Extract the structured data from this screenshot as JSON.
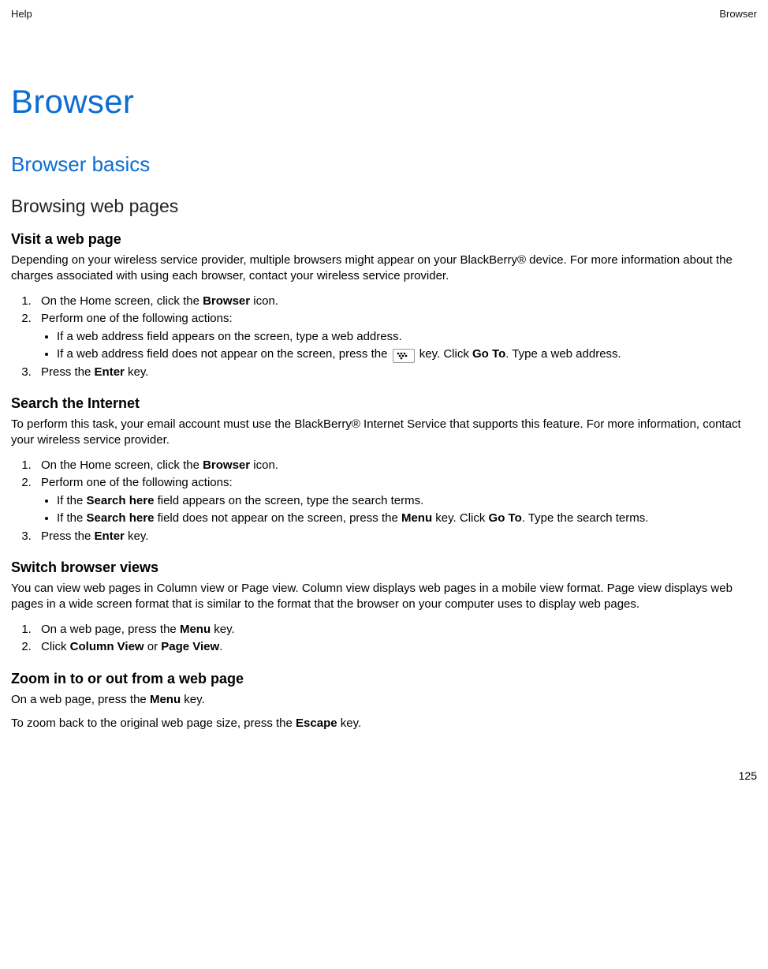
{
  "header": {
    "left": "Help",
    "right": "Browser"
  },
  "title": "Browser",
  "section": "Browser basics",
  "subsection": "Browsing web pages",
  "topics": {
    "visit": {
      "heading": "Visit a web page",
      "intro": "Depending on your wireless service provider, multiple browsers might appear on your BlackBerry® device. For more information about the charges associated with using each browser, contact your wireless service provider.",
      "step1_pre": "On the Home screen, click the ",
      "step1_b": "Browser",
      "step1_post": " icon.",
      "step2": "Perform one of the following actions:",
      "step2a": "If a web address field appears on the screen, type a web address.",
      "step2b_pre": "If a web address field does not appear on the screen, press the ",
      "step2b_mid": " key. Click ",
      "step2b_b": "Go To",
      "step2b_post": ". Type a web address.",
      "step3_pre": "Press the ",
      "step3_b": "Enter",
      "step3_post": " key."
    },
    "search": {
      "heading": "Search the Internet",
      "intro": "To perform this task, your email account must use the BlackBerry® Internet Service that supports this feature. For more information, contact your wireless service provider.",
      "step1_pre": "On the Home screen, click the ",
      "step1_b": "Browser",
      "step1_post": " icon.",
      "step2": "Perform one of the following actions:",
      "step2a_pre": "If the ",
      "step2a_b": "Search here",
      "step2a_post": " field appears on the screen, type the search terms.",
      "step2b_pre": "If the ",
      "step2b_b1": "Search here",
      "step2b_mid1": " field does not appear on the screen, press the ",
      "step2b_b2": "Menu",
      "step2b_mid2": " key. Click ",
      "step2b_b3": "Go To",
      "step2b_post": ". Type the search terms.",
      "step3_pre": "Press the ",
      "step3_b": "Enter",
      "step3_post": " key."
    },
    "switch": {
      "heading": "Switch browser views",
      "intro": "You can view web pages in Column view or Page view. Column view displays web pages in a mobile view format. Page view displays web pages in a wide screen format that is similar to the format that the browser on your computer uses to display web pages.",
      "step1_pre": "On a web page, press the ",
      "step1_b": "Menu",
      "step1_post": " key.",
      "step2_pre": "Click ",
      "step2_b1": "Column View",
      "step2_mid": " or ",
      "step2_b2": "Page View",
      "step2_post": "."
    },
    "zoom": {
      "heading": "Zoom in to or out from a web page",
      "p1_pre": "On a web page, press the ",
      "p1_b": "Menu",
      "p1_post": " key.",
      "p2_pre": "To zoom back to the original web page size, press the ",
      "p2_b": "Escape",
      "p2_post": " key."
    }
  },
  "page_number": "125"
}
